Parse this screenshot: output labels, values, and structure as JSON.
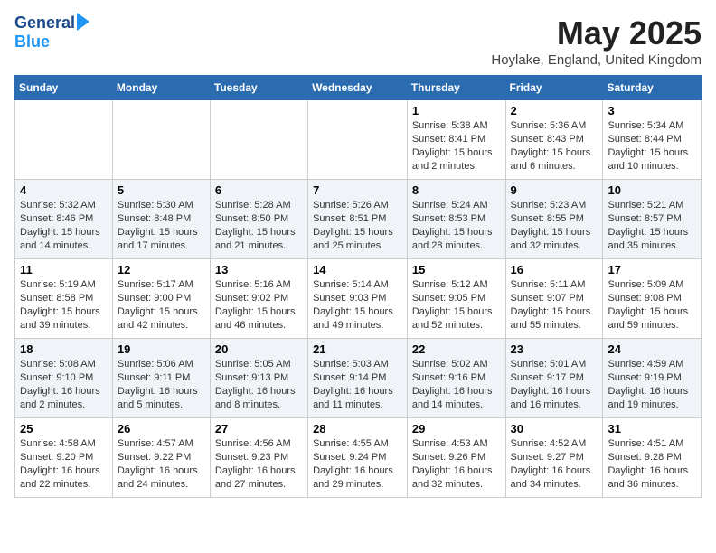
{
  "header": {
    "logo_line1": "General",
    "logo_line2": "Blue",
    "month_title": "May 2025",
    "location": "Hoylake, England, United Kingdom"
  },
  "weekdays": [
    "Sunday",
    "Monday",
    "Tuesday",
    "Wednesday",
    "Thursday",
    "Friday",
    "Saturday"
  ],
  "weeks": [
    [
      {
        "day": "",
        "content": ""
      },
      {
        "day": "",
        "content": ""
      },
      {
        "day": "",
        "content": ""
      },
      {
        "day": "",
        "content": ""
      },
      {
        "day": "1",
        "content": "Sunrise: 5:38 AM\nSunset: 8:41 PM\nDaylight: 15 hours\nand 2 minutes."
      },
      {
        "day": "2",
        "content": "Sunrise: 5:36 AM\nSunset: 8:43 PM\nDaylight: 15 hours\nand 6 minutes."
      },
      {
        "day": "3",
        "content": "Sunrise: 5:34 AM\nSunset: 8:44 PM\nDaylight: 15 hours\nand 10 minutes."
      }
    ],
    [
      {
        "day": "4",
        "content": "Sunrise: 5:32 AM\nSunset: 8:46 PM\nDaylight: 15 hours\nand 14 minutes."
      },
      {
        "day": "5",
        "content": "Sunrise: 5:30 AM\nSunset: 8:48 PM\nDaylight: 15 hours\nand 17 minutes."
      },
      {
        "day": "6",
        "content": "Sunrise: 5:28 AM\nSunset: 8:50 PM\nDaylight: 15 hours\nand 21 minutes."
      },
      {
        "day": "7",
        "content": "Sunrise: 5:26 AM\nSunset: 8:51 PM\nDaylight: 15 hours\nand 25 minutes."
      },
      {
        "day": "8",
        "content": "Sunrise: 5:24 AM\nSunset: 8:53 PM\nDaylight: 15 hours\nand 28 minutes."
      },
      {
        "day": "9",
        "content": "Sunrise: 5:23 AM\nSunset: 8:55 PM\nDaylight: 15 hours\nand 32 minutes."
      },
      {
        "day": "10",
        "content": "Sunrise: 5:21 AM\nSunset: 8:57 PM\nDaylight: 15 hours\nand 35 minutes."
      }
    ],
    [
      {
        "day": "11",
        "content": "Sunrise: 5:19 AM\nSunset: 8:58 PM\nDaylight: 15 hours\nand 39 minutes."
      },
      {
        "day": "12",
        "content": "Sunrise: 5:17 AM\nSunset: 9:00 PM\nDaylight: 15 hours\nand 42 minutes."
      },
      {
        "day": "13",
        "content": "Sunrise: 5:16 AM\nSunset: 9:02 PM\nDaylight: 15 hours\nand 46 minutes."
      },
      {
        "day": "14",
        "content": "Sunrise: 5:14 AM\nSunset: 9:03 PM\nDaylight: 15 hours\nand 49 minutes."
      },
      {
        "day": "15",
        "content": "Sunrise: 5:12 AM\nSunset: 9:05 PM\nDaylight: 15 hours\nand 52 minutes."
      },
      {
        "day": "16",
        "content": "Sunrise: 5:11 AM\nSunset: 9:07 PM\nDaylight: 15 hours\nand 55 minutes."
      },
      {
        "day": "17",
        "content": "Sunrise: 5:09 AM\nSunset: 9:08 PM\nDaylight: 15 hours\nand 59 minutes."
      }
    ],
    [
      {
        "day": "18",
        "content": "Sunrise: 5:08 AM\nSunset: 9:10 PM\nDaylight: 16 hours\nand 2 minutes."
      },
      {
        "day": "19",
        "content": "Sunrise: 5:06 AM\nSunset: 9:11 PM\nDaylight: 16 hours\nand 5 minutes."
      },
      {
        "day": "20",
        "content": "Sunrise: 5:05 AM\nSunset: 9:13 PM\nDaylight: 16 hours\nand 8 minutes."
      },
      {
        "day": "21",
        "content": "Sunrise: 5:03 AM\nSunset: 9:14 PM\nDaylight: 16 hours\nand 11 minutes."
      },
      {
        "day": "22",
        "content": "Sunrise: 5:02 AM\nSunset: 9:16 PM\nDaylight: 16 hours\nand 14 minutes."
      },
      {
        "day": "23",
        "content": "Sunrise: 5:01 AM\nSunset: 9:17 PM\nDaylight: 16 hours\nand 16 minutes."
      },
      {
        "day": "24",
        "content": "Sunrise: 4:59 AM\nSunset: 9:19 PM\nDaylight: 16 hours\nand 19 minutes."
      }
    ],
    [
      {
        "day": "25",
        "content": "Sunrise: 4:58 AM\nSunset: 9:20 PM\nDaylight: 16 hours\nand 22 minutes."
      },
      {
        "day": "26",
        "content": "Sunrise: 4:57 AM\nSunset: 9:22 PM\nDaylight: 16 hours\nand 24 minutes."
      },
      {
        "day": "27",
        "content": "Sunrise: 4:56 AM\nSunset: 9:23 PM\nDaylight: 16 hours\nand 27 minutes."
      },
      {
        "day": "28",
        "content": "Sunrise: 4:55 AM\nSunset: 9:24 PM\nDaylight: 16 hours\nand 29 minutes."
      },
      {
        "day": "29",
        "content": "Sunrise: 4:53 AM\nSunset: 9:26 PM\nDaylight: 16 hours\nand 32 minutes."
      },
      {
        "day": "30",
        "content": "Sunrise: 4:52 AM\nSunset: 9:27 PM\nDaylight: 16 hours\nand 34 minutes."
      },
      {
        "day": "31",
        "content": "Sunrise: 4:51 AM\nSunset: 9:28 PM\nDaylight: 16 hours\nand 36 minutes."
      }
    ]
  ]
}
